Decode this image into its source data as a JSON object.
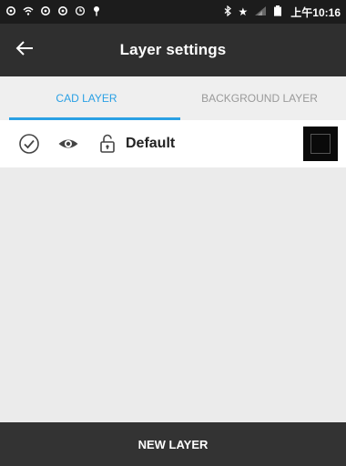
{
  "status_bar": {
    "time": "上午10:16",
    "left_icons": [
      "sync-icon",
      "wifi-icon",
      "sync-icon",
      "sync-icon",
      "clock-icon",
      "pin-icon"
    ],
    "right_icons": [
      "bluetooth-icon",
      "star-icon",
      "signal-icon",
      "battery-icon"
    ]
  },
  "app_bar": {
    "title": "Layer settings",
    "back_icon": "back-arrow-icon"
  },
  "tabs": [
    {
      "label": "CAD LAYER",
      "active": true
    },
    {
      "label": "BACKGROUND LAYER",
      "active": false
    }
  ],
  "layers": [
    {
      "name": "Default",
      "checked": true,
      "visible": true,
      "locked": false,
      "color": "#000000"
    }
  ],
  "bottom_button": {
    "label": "NEW LAYER"
  },
  "colors": {
    "accent": "#2aa0e4",
    "app_bar": "#2f2f2f",
    "bottom_bar": "#333333"
  }
}
